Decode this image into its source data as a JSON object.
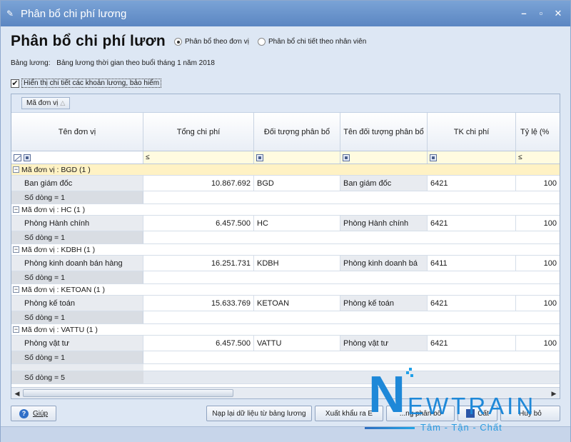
{
  "window": {
    "title": "Phân bổ chi phí lương"
  },
  "header": {
    "title": "Phân bổ chi phí lươn",
    "radio_by_unit": "Phân bổ theo đơn vị",
    "radio_by_employee": "Phân bổ chi tiết theo nhân viên"
  },
  "payroll": {
    "label": "Bảng lương:",
    "value": "Bảng lương thời gian theo buổi tháng 1 năm 2018"
  },
  "show_detail_checkbox": {
    "checked": true,
    "label": "Hiển thị chi tiết các khoản lương, bảo hiểm"
  },
  "grid": {
    "group_chip": "Mã đơn vị",
    "columns": [
      "Tên đơn vị",
      "Tổng chi phí",
      "Đối tượng phân bổ",
      "Tên đối tượng phân bổ",
      "TK chi phí",
      "Tỷ lệ (%"
    ],
    "filter_symbols": [
      "≤",
      "≤"
    ],
    "groups": [
      {
        "header": "Mã đơn vị : BGD (1 )",
        "row": [
          "Ban giám đốc",
          "10.867.692",
          "BGD",
          "Ban giám đốc",
          "6421",
          "100"
        ],
        "count": "Số dòng = 1"
      },
      {
        "header": "Mã đơn vị : HC (1 )",
        "row": [
          "Phòng Hành chính",
          "6.457.500",
          "HC",
          "Phòng Hành chính",
          "6421",
          "100"
        ],
        "count": "Số dòng = 1"
      },
      {
        "header": "Mã đơn vị : KDBH (1 )",
        "row": [
          "Phòng kinh doanh bán hàng",
          "16.251.731",
          "KDBH",
          "Phòng kinh doanh bá",
          "6411",
          "100"
        ],
        "count": "Số dòng = 1"
      },
      {
        "header": "Mã đơn vị : KETOAN (1 )",
        "row": [
          "Phòng kế toán",
          "15.633.769",
          "KETOAN",
          "Phòng kế toán",
          "6421",
          "100"
        ],
        "count": "Số dòng = 1"
      },
      {
        "header": "Mã đơn vị : VATTU (1 )",
        "row": [
          "Phòng vật tư",
          "6.457.500",
          "VATTU",
          "Phòng vật tư",
          "6421",
          "100"
        ],
        "count": "Số dòng = 1"
      }
    ],
    "total": "Số dòng = 5"
  },
  "buttons": {
    "help": "Giúp",
    "reload": "Nạp lại dữ liệu từ bảng lương",
    "export": "Xuất khẩu ra E",
    "allocate": "...ng phân bổ",
    "save": "Cất",
    "cancel": "Huỷ bỏ"
  },
  "logo": {
    "text_n": "N",
    "text_rest": "EWTRAIN",
    "tagline": "Tâm - Tận - Chất"
  }
}
